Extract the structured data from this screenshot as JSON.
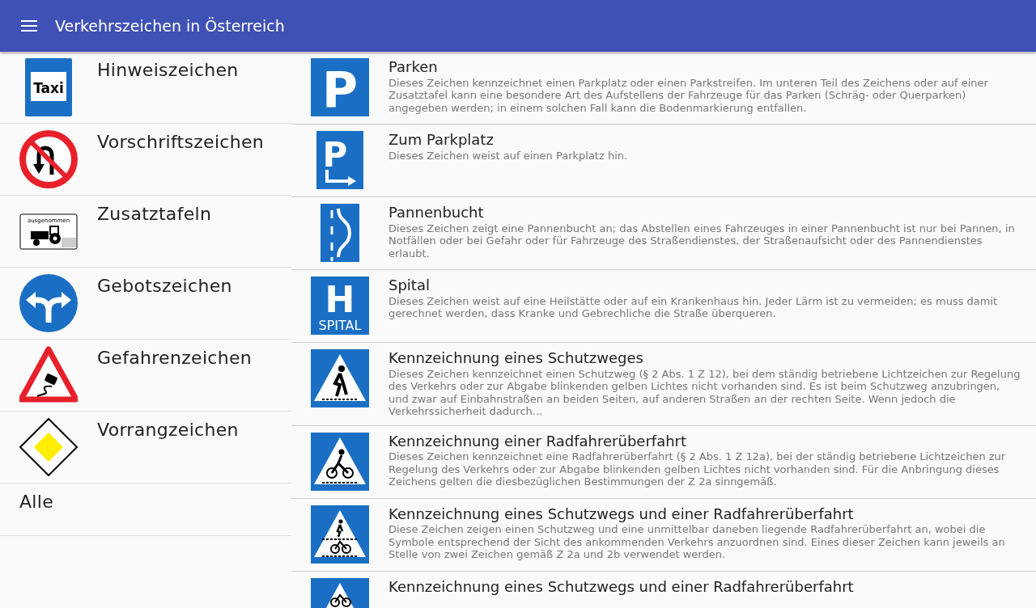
{
  "app_bar": {
    "title": "Verkehrszeichen in Österreich"
  },
  "categories": [
    {
      "kind": "taxi",
      "label": "Hinweiszeichen",
      "sign_text": "Taxi"
    },
    {
      "kind": "no-u-turn",
      "label": "Vorschriftszeichen"
    },
    {
      "kind": "tractor-plate",
      "label": "Zusatztafeln",
      "sign_text": "ausgenommen"
    },
    {
      "kind": "fork-arrows",
      "label": "Gebotszeichen"
    },
    {
      "kind": "skid-triangle",
      "label": "Gefahrenzeichen"
    },
    {
      "kind": "priority-diamond",
      "label": "Vorrangzeichen"
    },
    {
      "kind": "none",
      "label": "Alle"
    }
  ],
  "signs": [
    {
      "kind": "parking",
      "sign_text": "P",
      "title": "Parken",
      "description": "Dieses Zeichen kennzeichnet einen Parkplatz oder einen Parkstreifen. Im unteren Teil des Zeichens oder auf einer Zusatztafel kann eine besondere Art des Aufstellens der Fahrzeuge für das Parken (Schräg- oder Querparken) angegeben werden; in einem solchen Fall kann die Bodenmarkierung entfallen."
    },
    {
      "kind": "to-parking",
      "sign_text": "P",
      "title": "Zum Parkplatz",
      "description": "Dieses Zeichen weist auf einen Parkplatz hin."
    },
    {
      "kind": "layby",
      "title": "Pannenbucht",
      "description": "Dieses Zeichen zeigt eine Pannenbucht an; das Abstellen eines Fahrzeuges in einer Pannenbucht ist nur bei Pannen, in Notfällen oder bei Gefahr oder für Fahrzeuge des Straßendienstes, der Straßenaufsicht oder des Pannendienstes erlaubt."
    },
    {
      "kind": "hospital",
      "sign_text": "H",
      "sign_caption": "SPITAL",
      "title": "Spital",
      "description": "Dieses Zeichen weist auf eine Heilstätte oder auf ein Krankenhaus hin. Jeder Lärm ist zu vermeiden; es muss damit gerechnet werden, dass Kranke und Gebrechliche die Straße überqueren."
    },
    {
      "kind": "crosswalk",
      "title": "Kennzeichnung eines Schutzweges",
      "description": "Dieses Zeichen kennzeichnet einen Schutzweg (§ 2 Abs. 1 Z 12), bei dem ständig betriebene Lichtzeichen zur Regelung des Verkehrs oder zur Abgabe blinkenden gelben Lichtes nicht vorhanden sind. Es ist beim Schutzweg anzubringen, und zwar auf Einbahnstraßen an beiden Seiten, auf anderen Straßen an der rechten Seite. Wenn jedoch die Verkehrssicherheit dadurch…"
    },
    {
      "kind": "bike-crossing",
      "title": "Kennzeichnung einer Radfahrerüberfahrt",
      "description": "Dieses Zeichen kennzeichnet eine Radfahrerüberfahrt (§ 2 Abs. 1 Z 12a), bei der ständig betriebene Lichtzeichen zur Regelung des Verkehrs oder zur Abgabe blinkenden gelben Lichtes nicht vorhanden sind. Für die Anbringung dieses Zeichens gelten die diesbezüglichen Bestimmungen der Z 2a sinngemäß."
    },
    {
      "kind": "crosswalk-bike",
      "title": "Kennzeichnung eines Schutzwegs und einer Radfahrerüberfahrt",
      "description": "Diese Zeichen zeigen einen Schutzweg und eine unmittelbar daneben liegende Radfahrerüberfahrt an, wobei die Symbole entsprechend der Sicht des ankommenden Verkehrs anzuordnen sind. Eines dieser Zeichen kann jeweils an Stelle von zwei Zeichen gemäß Z 2a und 2b verwendet werden."
    },
    {
      "kind": "bike-only",
      "title": "Kennzeichnung eines Schutzwegs und einer Radfahrerüberfahrt"
    }
  ]
}
